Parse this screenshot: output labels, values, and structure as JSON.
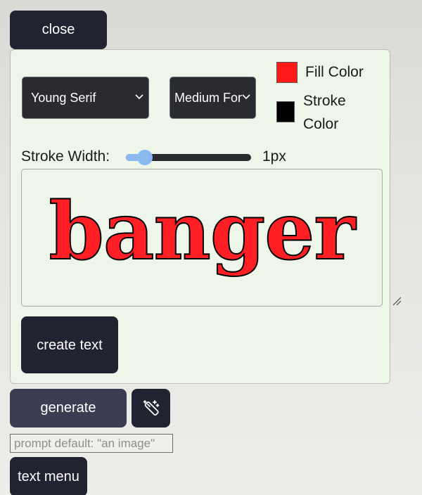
{
  "buttons": {
    "close": "close",
    "create_text": "create text",
    "generate": "generate",
    "text_menu": "text menu"
  },
  "text_panel": {
    "font_select": {
      "selected": "Young Serif"
    },
    "size_select": {
      "selected": "Medium Font"
    },
    "fill": {
      "label": "Fill Color",
      "color": "#ff1a1a"
    },
    "stroke": {
      "label": "Stroke Color",
      "color": "#000000"
    },
    "stroke_width": {
      "label": "Stroke Width:",
      "value_label": "1px",
      "fraction": 0.15
    },
    "preview_text": "banger"
  },
  "prompt": {
    "placeholder": "prompt default: \"an image\""
  },
  "icons": {
    "wand": "magic-wand-icon",
    "chevron": "chevron-down-icon"
  },
  "colors": {
    "button_dark": "#222330",
    "panel_bg": "#eef6ea",
    "slider_accent": "#8ab8ef"
  }
}
